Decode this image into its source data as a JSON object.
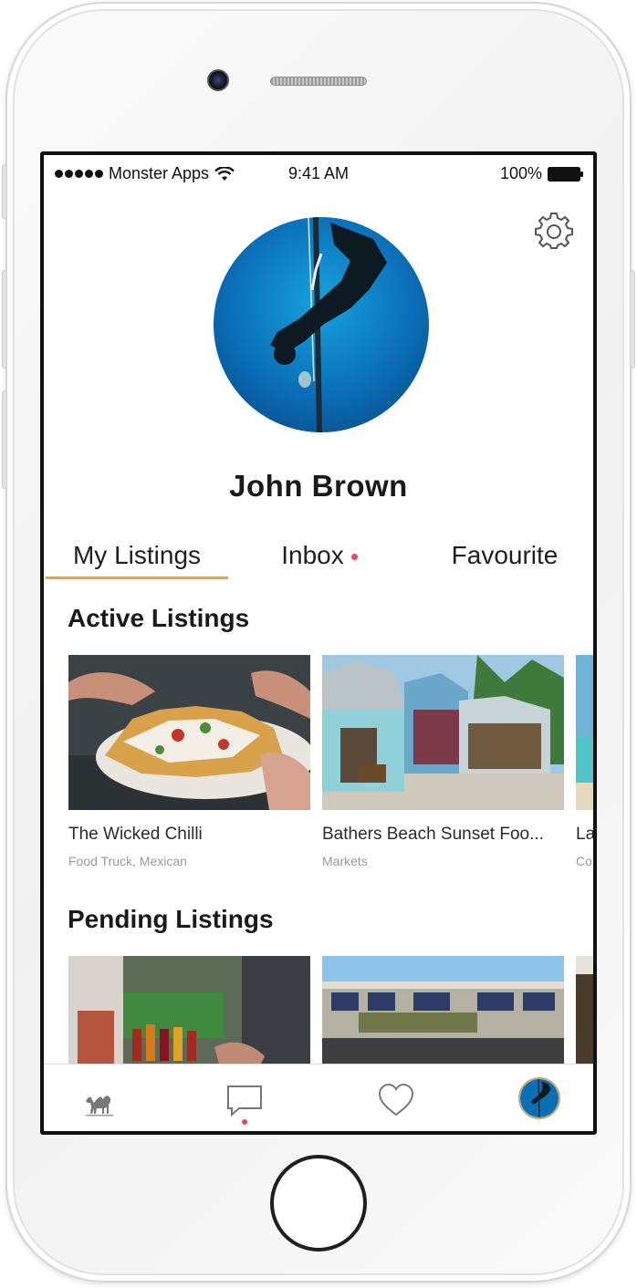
{
  "status_bar": {
    "carrier": "Monster Apps",
    "time": "9:41 AM",
    "battery": "100%"
  },
  "profile": {
    "name": "John Brown"
  },
  "tabs": [
    {
      "label": "My Listings",
      "active": true
    },
    {
      "label": "Inbox",
      "active": false,
      "has_notification": true
    },
    {
      "label": "Favourite",
      "active": false
    }
  ],
  "sections": {
    "active": {
      "title": "Active Listings",
      "cards": [
        {
          "title": "The Wicked Chilli",
          "subtitle": "Food Truck, Mexican"
        },
        {
          "title": "Bathers Beach Sunset Foo...",
          "subtitle": "Markets"
        },
        {
          "title": "La",
          "subtitle": "Co"
        }
      ]
    },
    "pending": {
      "title": "Pending Listings"
    }
  },
  "tab_bar": {
    "items": [
      "camel-icon",
      "chat-icon",
      "heart-icon",
      "profile-avatar"
    ],
    "chat_has_notification": true
  },
  "colors": {
    "accent": "#c9a86a",
    "notification": "#f0436c",
    "text_primary": "#1a1a1a",
    "text_muted": "#9a9a9a"
  }
}
